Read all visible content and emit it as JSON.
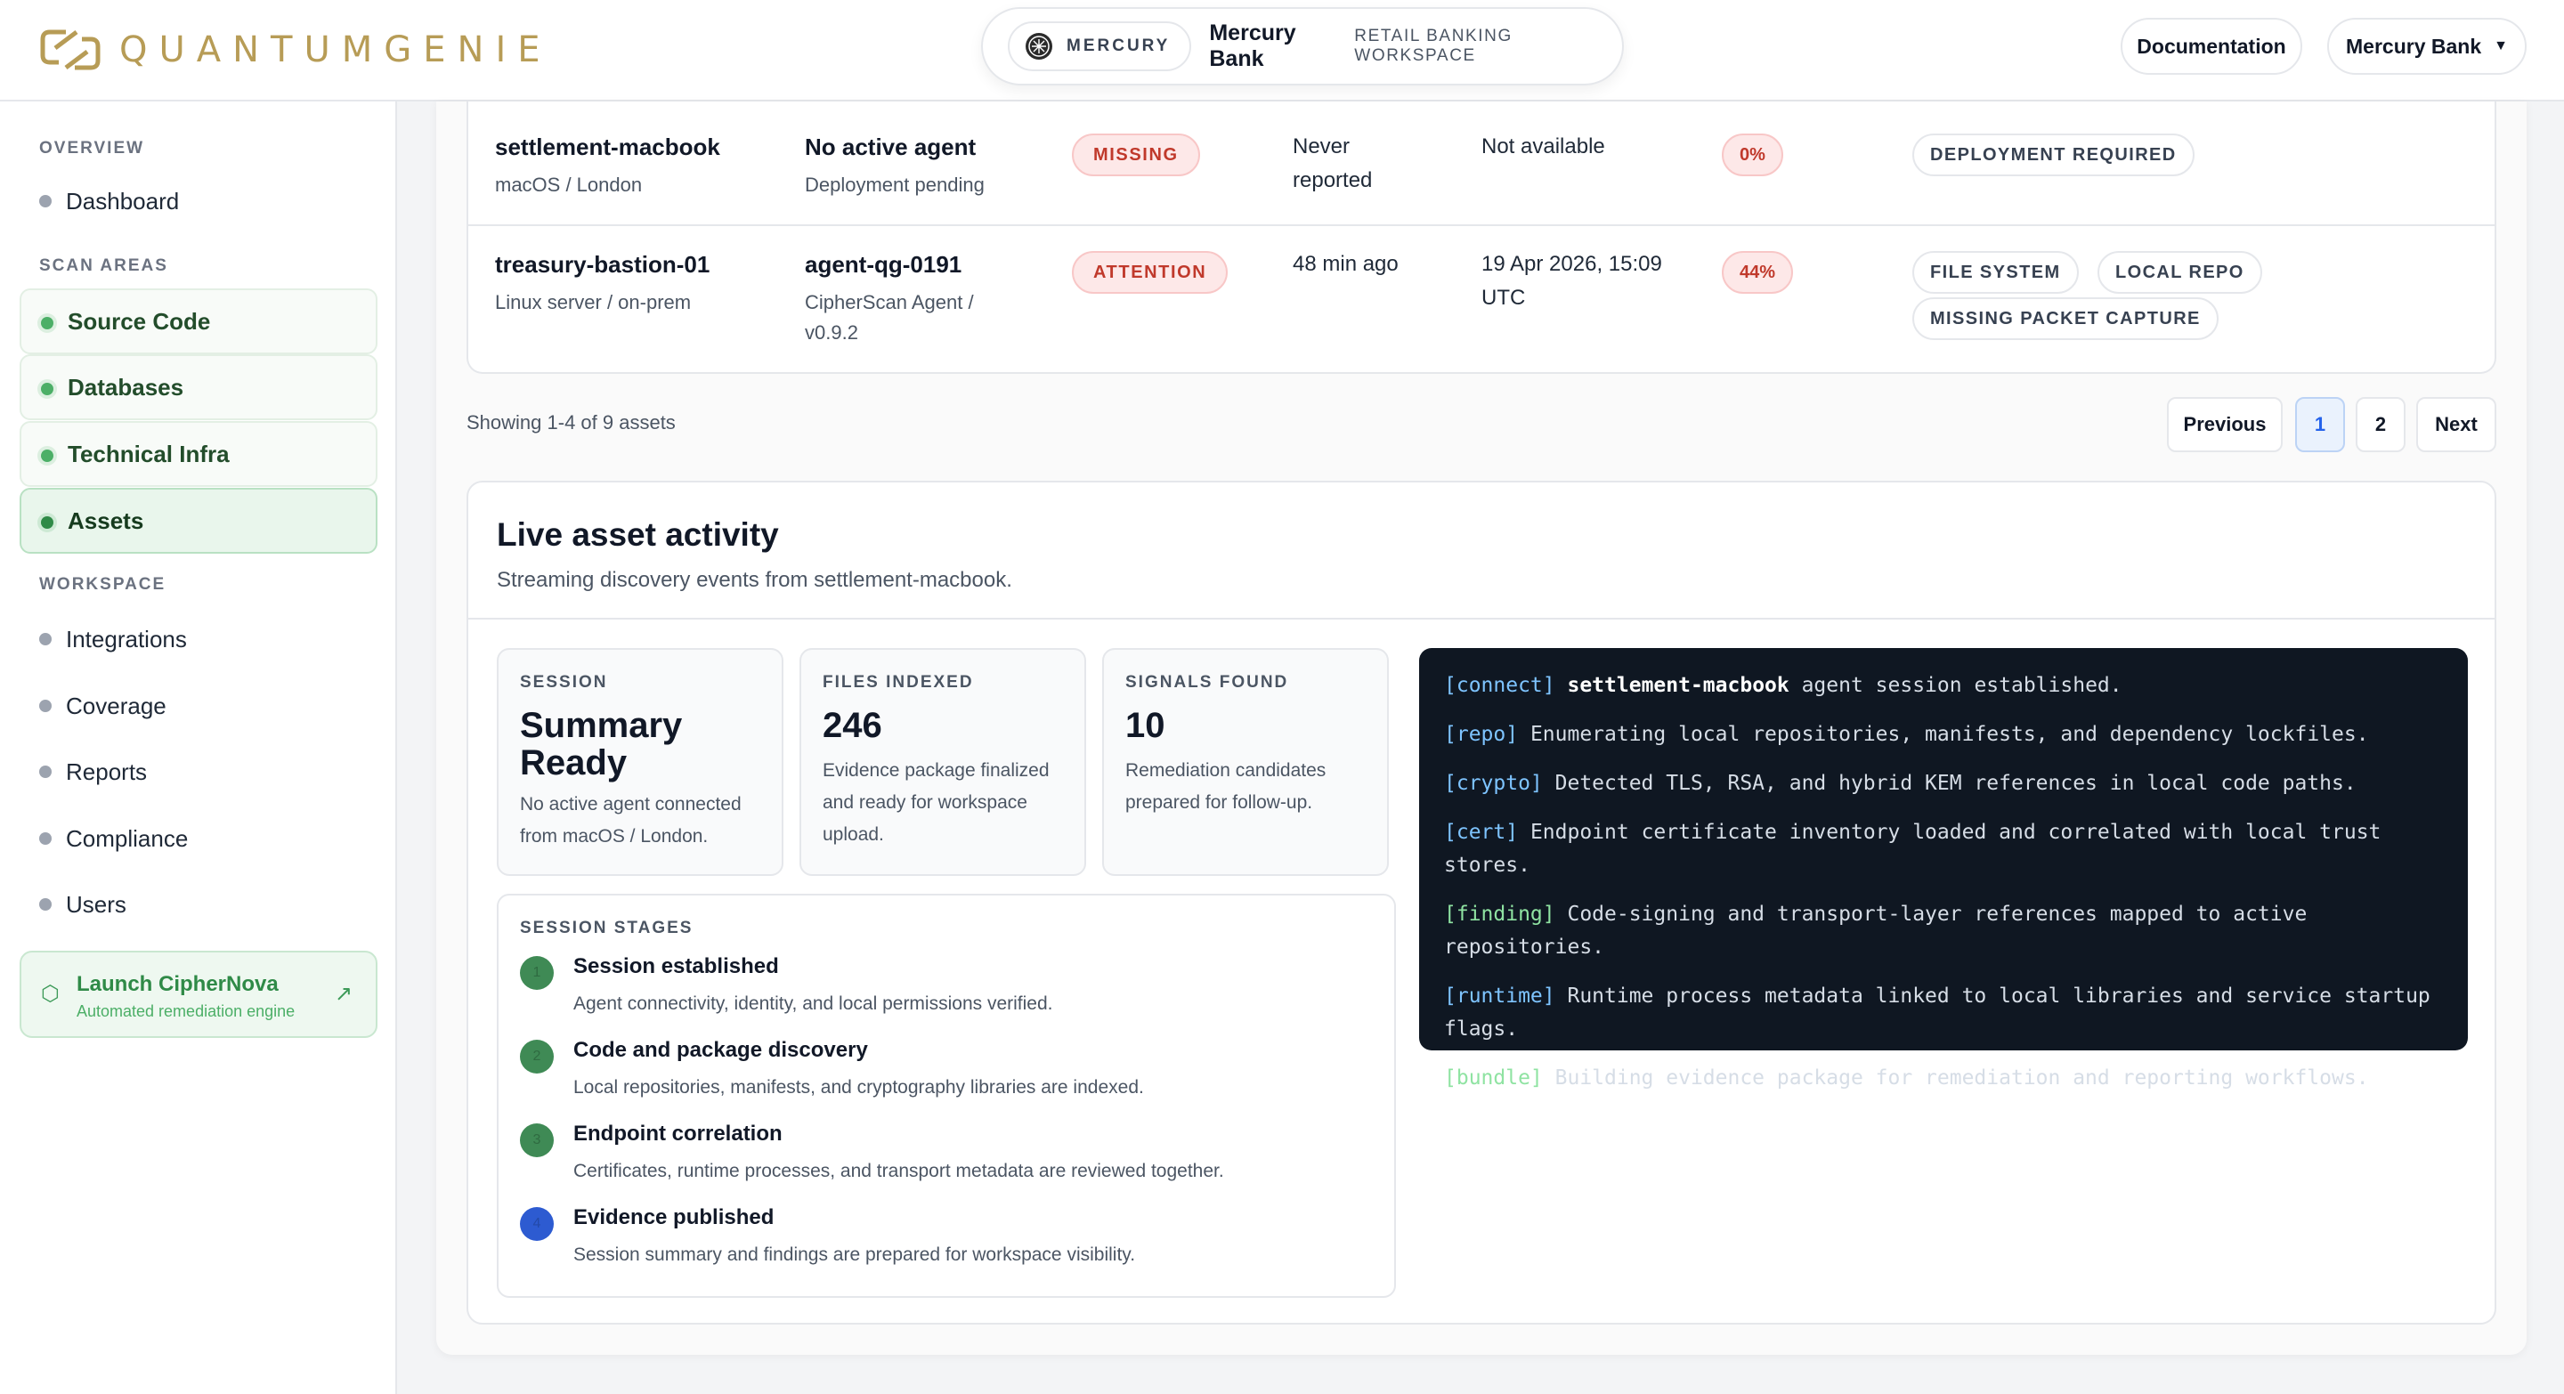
{
  "brand": {
    "name": "QUANTUMGENIE"
  },
  "workspace": {
    "badge": "MERCURY",
    "name": "Mercury Bank",
    "subtitle": "RETAIL BANKING WORKSPACE"
  },
  "header": {
    "documentation": "Documentation",
    "account": "Mercury Bank"
  },
  "sidebar": {
    "overview_label": "OVERVIEW",
    "dashboard": "Dashboard",
    "scan_label": "SCAN AREAS",
    "scan_items": [
      "Source Code",
      "Databases",
      "Technical Infra",
      "Assets"
    ],
    "workspace_label": "WORKSPACE",
    "workspace_items": [
      "Integrations",
      "Coverage",
      "Reports",
      "Compliance",
      "Users"
    ],
    "launch": {
      "title": "Launch CipherNova",
      "subtitle": "Automated remediation engine"
    }
  },
  "assets": {
    "rows": [
      {
        "name": "settlement-macbook",
        "platform": "macOS / London",
        "agent": "No active agent",
        "agent_detail": "Deployment pending",
        "status": "MISSING",
        "last_seen": "Never reported",
        "last_scan": "Not available",
        "coverage": "0%",
        "tags": [
          "DEPLOYMENT REQUIRED"
        ]
      },
      {
        "name": "treasury-bastion-01",
        "platform": "Linux server / on-prem",
        "agent": "agent-qg-0191",
        "agent_detail": "CipherScan Agent / v0.9.2",
        "status": "ATTENTION",
        "last_seen": "48 min ago",
        "last_scan": "19 Apr 2026, 15:09 UTC",
        "coverage": "44%",
        "tags": [
          "FILE SYSTEM",
          "LOCAL REPO",
          "MISSING PACKET CAPTURE"
        ]
      }
    ],
    "showing": "Showing 1-4 of 9 assets",
    "pagination": {
      "previous": "Previous",
      "pages": [
        "1",
        "2"
      ],
      "current": "1",
      "next": "Next"
    }
  },
  "activity": {
    "title": "Live asset activity",
    "subtitle": "Streaming discovery events from settlement-macbook.",
    "stats": [
      {
        "label": "SESSION",
        "value": "Summary Ready",
        "desc": "No active agent connected from macOS / London."
      },
      {
        "label": "FILES INDEXED",
        "value": "246",
        "desc": "Evidence package finalized and ready for workspace upload."
      },
      {
        "label": "SIGNALS FOUND",
        "value": "10",
        "desc": "Remediation candidates prepared for follow-up."
      }
    ],
    "stages_label": "SESSION STAGES",
    "stages": [
      {
        "num": "1",
        "title": "Session established",
        "desc": "Agent connectivity, identity, and local permissions verified."
      },
      {
        "num": "2",
        "title": "Code and package discovery",
        "desc": "Local repositories, manifests, and cryptography libraries are indexed."
      },
      {
        "num": "3",
        "title": "Endpoint correlation",
        "desc": "Certificates, runtime processes, and transport metadata are reviewed together."
      },
      {
        "num": "4",
        "title": "Evidence published",
        "desc": "Session summary and findings are prepared for workspace visibility."
      }
    ],
    "log": [
      {
        "tag": "[connect]",
        "strong": "settlement-macbook",
        "text": " agent session established."
      },
      {
        "tag": "[repo]",
        "strong": "",
        "text": " Enumerating local repositories, manifests, and dependency lockfiles."
      },
      {
        "tag": "[crypto]",
        "strong": "",
        "text": " Detected TLS, RSA, and hybrid KEM references in local code paths."
      },
      {
        "tag": "[cert]",
        "strong": "",
        "text": " Endpoint certificate inventory loaded and correlated with local trust stores."
      },
      {
        "tag": "[finding]",
        "strong": "",
        "text": " Code-signing and transport-layer references mapped to active repositories."
      },
      {
        "tag": "[runtime]",
        "strong": "",
        "text": " Runtime process metadata linked to local libraries and service startup flags."
      },
      {
        "tag": "[bundle]",
        "strong": "",
        "text": " Building evidence package for remediation and reporting workflows."
      }
    ]
  },
  "colors": {
    "brand_gold": "#b79c56",
    "accent_green": "#2f8a47",
    "danger": "#c0392b",
    "terminal_bg": "#0f1722"
  },
  "icons": {
    "brand": "qg-logo-icon",
    "bank": "mercury-logo-icon",
    "launch": "hexagon-icon",
    "external": "arrow-up-right-icon",
    "caret": "chevron-down-icon"
  }
}
